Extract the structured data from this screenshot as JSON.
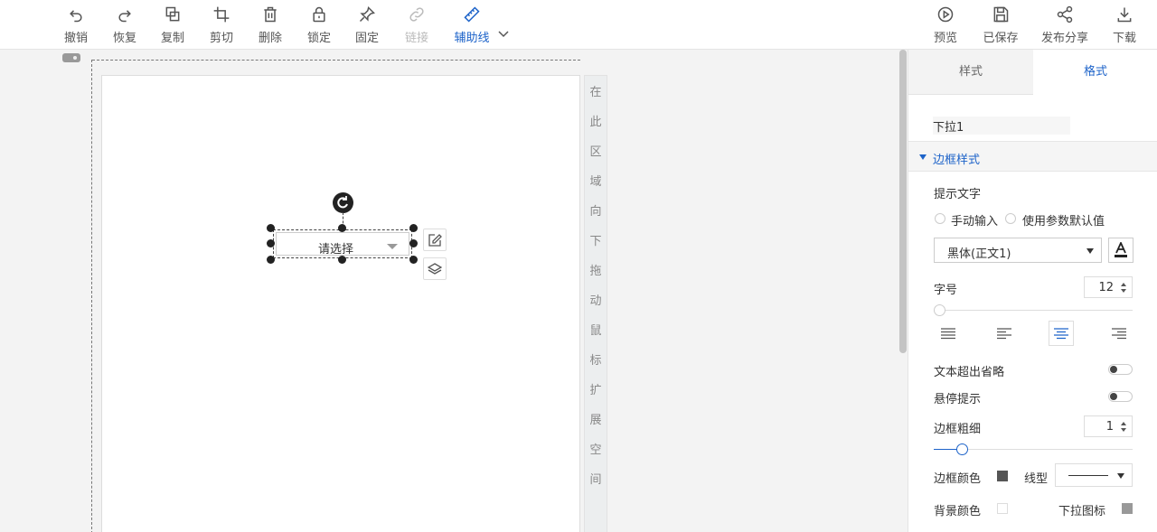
{
  "toolbar": {
    "left": [
      {
        "label": "撤销",
        "icon": "undo-icon"
      },
      {
        "label": "恢复",
        "icon": "redo-icon"
      },
      {
        "label": "复制",
        "icon": "copy-icon"
      },
      {
        "label": "剪切",
        "icon": "crop-icon"
      },
      {
        "label": "删除",
        "icon": "trash-icon"
      },
      {
        "label": "锁定",
        "icon": "lock-icon"
      },
      {
        "label": "固定",
        "icon": "pin-icon"
      },
      {
        "label": "链接",
        "icon": "link-icon",
        "state": "disabled"
      },
      {
        "label": "辅助线",
        "icon": "ruler-icon",
        "state": "active"
      }
    ],
    "right": [
      {
        "label": "预览",
        "icon": "play-icon"
      },
      {
        "label": "已保存",
        "icon": "save-icon"
      },
      {
        "label": "发布分享",
        "icon": "share-icon"
      },
      {
        "label": "下载",
        "icon": "download-icon"
      }
    ]
  },
  "canvas": {
    "hint_chars": [
      "在",
      "此",
      "区",
      "域",
      "向",
      "下",
      "拖",
      "动",
      "鼠",
      "标",
      "扩",
      "展",
      "空",
      "间"
    ],
    "widget": {
      "placeholder": "请选择"
    }
  },
  "panel": {
    "tabs": [
      "样式",
      "格式"
    ],
    "active_tab": "格式",
    "component_name": "下拉1",
    "section_title": "边框样式",
    "hint_text_label": "提示文字",
    "radio_manual": "手动输入",
    "radio_param": "使用参数默认值",
    "font_family": "黑体(正文1)",
    "font_size_label": "字号",
    "font_size": "12",
    "font_size_fraction": 0.0,
    "align_selected": "center",
    "ellipsis_label": "文本超出省略",
    "hover_tip_label": "悬停提示",
    "border_width_label": "边框粗细",
    "border_width": "1",
    "border_width_fraction": 0.12,
    "border_color_label": "边框颜色",
    "line_type_label": "线型",
    "bg_color_label": "背景颜色",
    "dropdown_icon_label": "下拉图标",
    "colors": {
      "accent": "#1d63c9",
      "border_color": "#555555",
      "bg_color": "#ffffff",
      "dropdown_icon_color": "#999999"
    }
  }
}
